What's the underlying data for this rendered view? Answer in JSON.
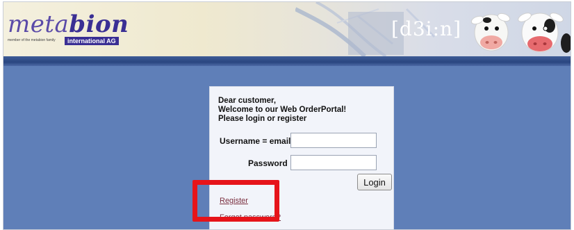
{
  "header": {
    "logo": {
      "meta": "meta",
      "bion": "bion",
      "tagline": "member of the metabion family",
      "subtitle": "international AG"
    },
    "product_name": "[d3i:n]"
  },
  "login": {
    "greeting_line1": "Dear customer,",
    "greeting_line2": "Welcome to our Web OrderPortal!",
    "greeting_line3": "Please login or register",
    "username_label": "Username = email",
    "username_value": "",
    "password_label": "Password",
    "password_value": "",
    "login_button": "Login",
    "register_link": "Register",
    "forgot_password_link": "Forgot password?"
  },
  "colors": {
    "page_background": "#5f7fb8",
    "header_stripe": "#2a4680",
    "logo_brand": "#3a2f94",
    "link": "#7a2e3e",
    "annotation_highlight": "#e6141a"
  }
}
